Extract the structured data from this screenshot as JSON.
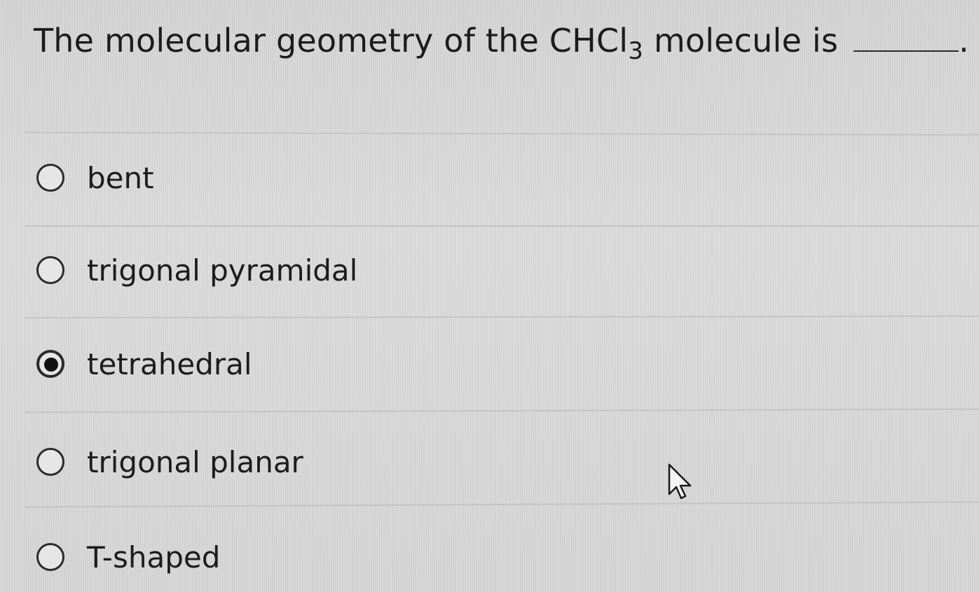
{
  "question": {
    "prefix": "The molecular geometry of the CHCl",
    "subscript": "3",
    "suffix": " molecule is",
    "end_punct": "."
  },
  "options": [
    {
      "label": "bent",
      "selected": false
    },
    {
      "label": "trigonal pyramidal",
      "selected": false
    },
    {
      "label": "tetrahedral",
      "selected": true
    },
    {
      "label": "trigonal planar",
      "selected": false
    },
    {
      "label": "T-shaped",
      "selected": false
    }
  ],
  "icons": {
    "radio_unselected": "radio-empty-icon",
    "radio_selected": "radio-filled-icon",
    "cursor": "mouse-pointer-icon"
  }
}
